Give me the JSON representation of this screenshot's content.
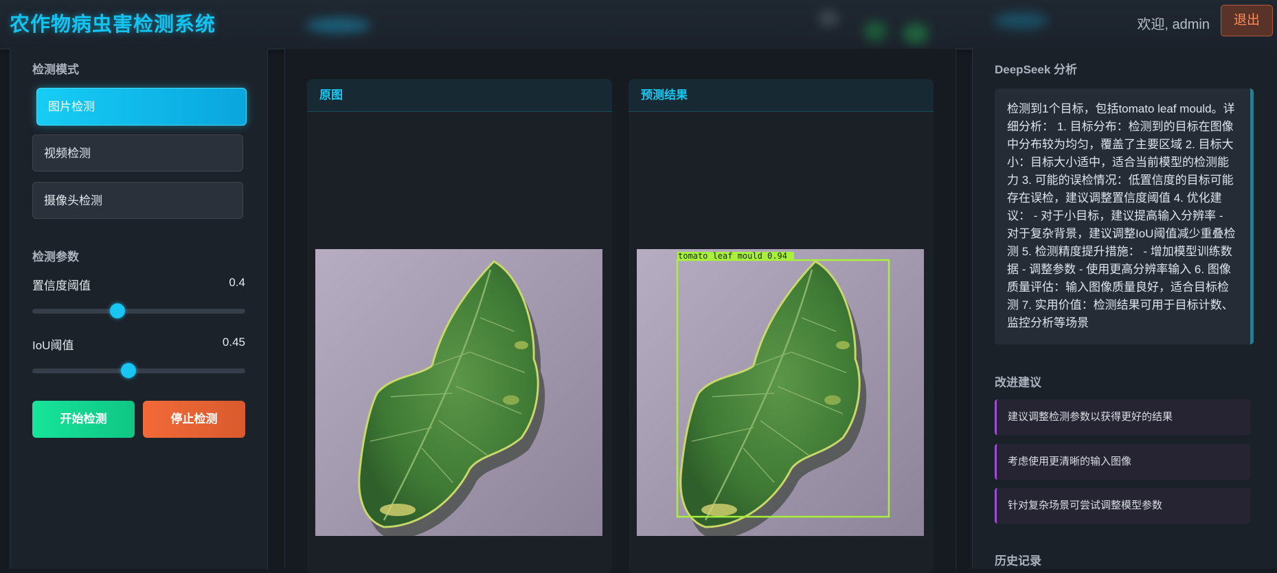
{
  "header": {
    "title": "农作物病虫害检测系统",
    "welcome": "欢迎, admin",
    "logout_label": "退出"
  },
  "left": {
    "mode_section": "检测模式",
    "modes": [
      {
        "label": "图片检测",
        "active": true
      },
      {
        "label": "视频检测",
        "active": false
      },
      {
        "label": "摄像头检测",
        "active": false
      }
    ],
    "params_section": "检测参数",
    "confidence": {
      "label": "置信度阈值",
      "value": "0.4",
      "fraction": 0.4
    },
    "iou": {
      "label": "IoU阈值",
      "value": "0.45",
      "fraction": 0.45
    },
    "start_label": "开始检测",
    "stop_label": "停止检测"
  },
  "center": {
    "original_title": "原图",
    "result_title": "预测结果",
    "detection_label": "tomato leaf mould 0.94"
  },
  "right": {
    "analysis_title": "DeepSeek 分析",
    "analysis_text": "检测到1个目标，包括tomato leaf mould。详细分析： 1. 目标分布：检测到的目标在图像中分布较为均匀，覆盖了主要区域 2. 目标大小：目标大小适中，适合当前模型的检测能力 3. 可能的误检情况：低置信度的目标可能存在误检，建议调整置信度阈值 4. 优化建议： - 对于小目标，建议提高输入分辨率 - 对于复杂背景，建议调整IoU阈值减少重叠检测 5. 检测精度提升措施： - 增加模型训练数据 - 调整参数 - 使用更高分辨率输入 6. 图像质量评估：输入图像质量良好，适合目标检测 7. 实用价值：检测结果可用于目标计数、监控分析等场景",
    "suggestions_title": "改进建议",
    "suggestions": [
      "建议调整检测参数以获得更好的结果",
      "考虑使用更清晰的输入图像",
      "针对复杂场景可尝试调整模型参数"
    ],
    "history_title": "历史记录"
  },
  "colors": {
    "accent": "#12c4f2",
    "start": "#17e49a",
    "stop": "#f26a37",
    "bbox": "#a8f03c",
    "suggestion_border": "#9a4fd6"
  }
}
